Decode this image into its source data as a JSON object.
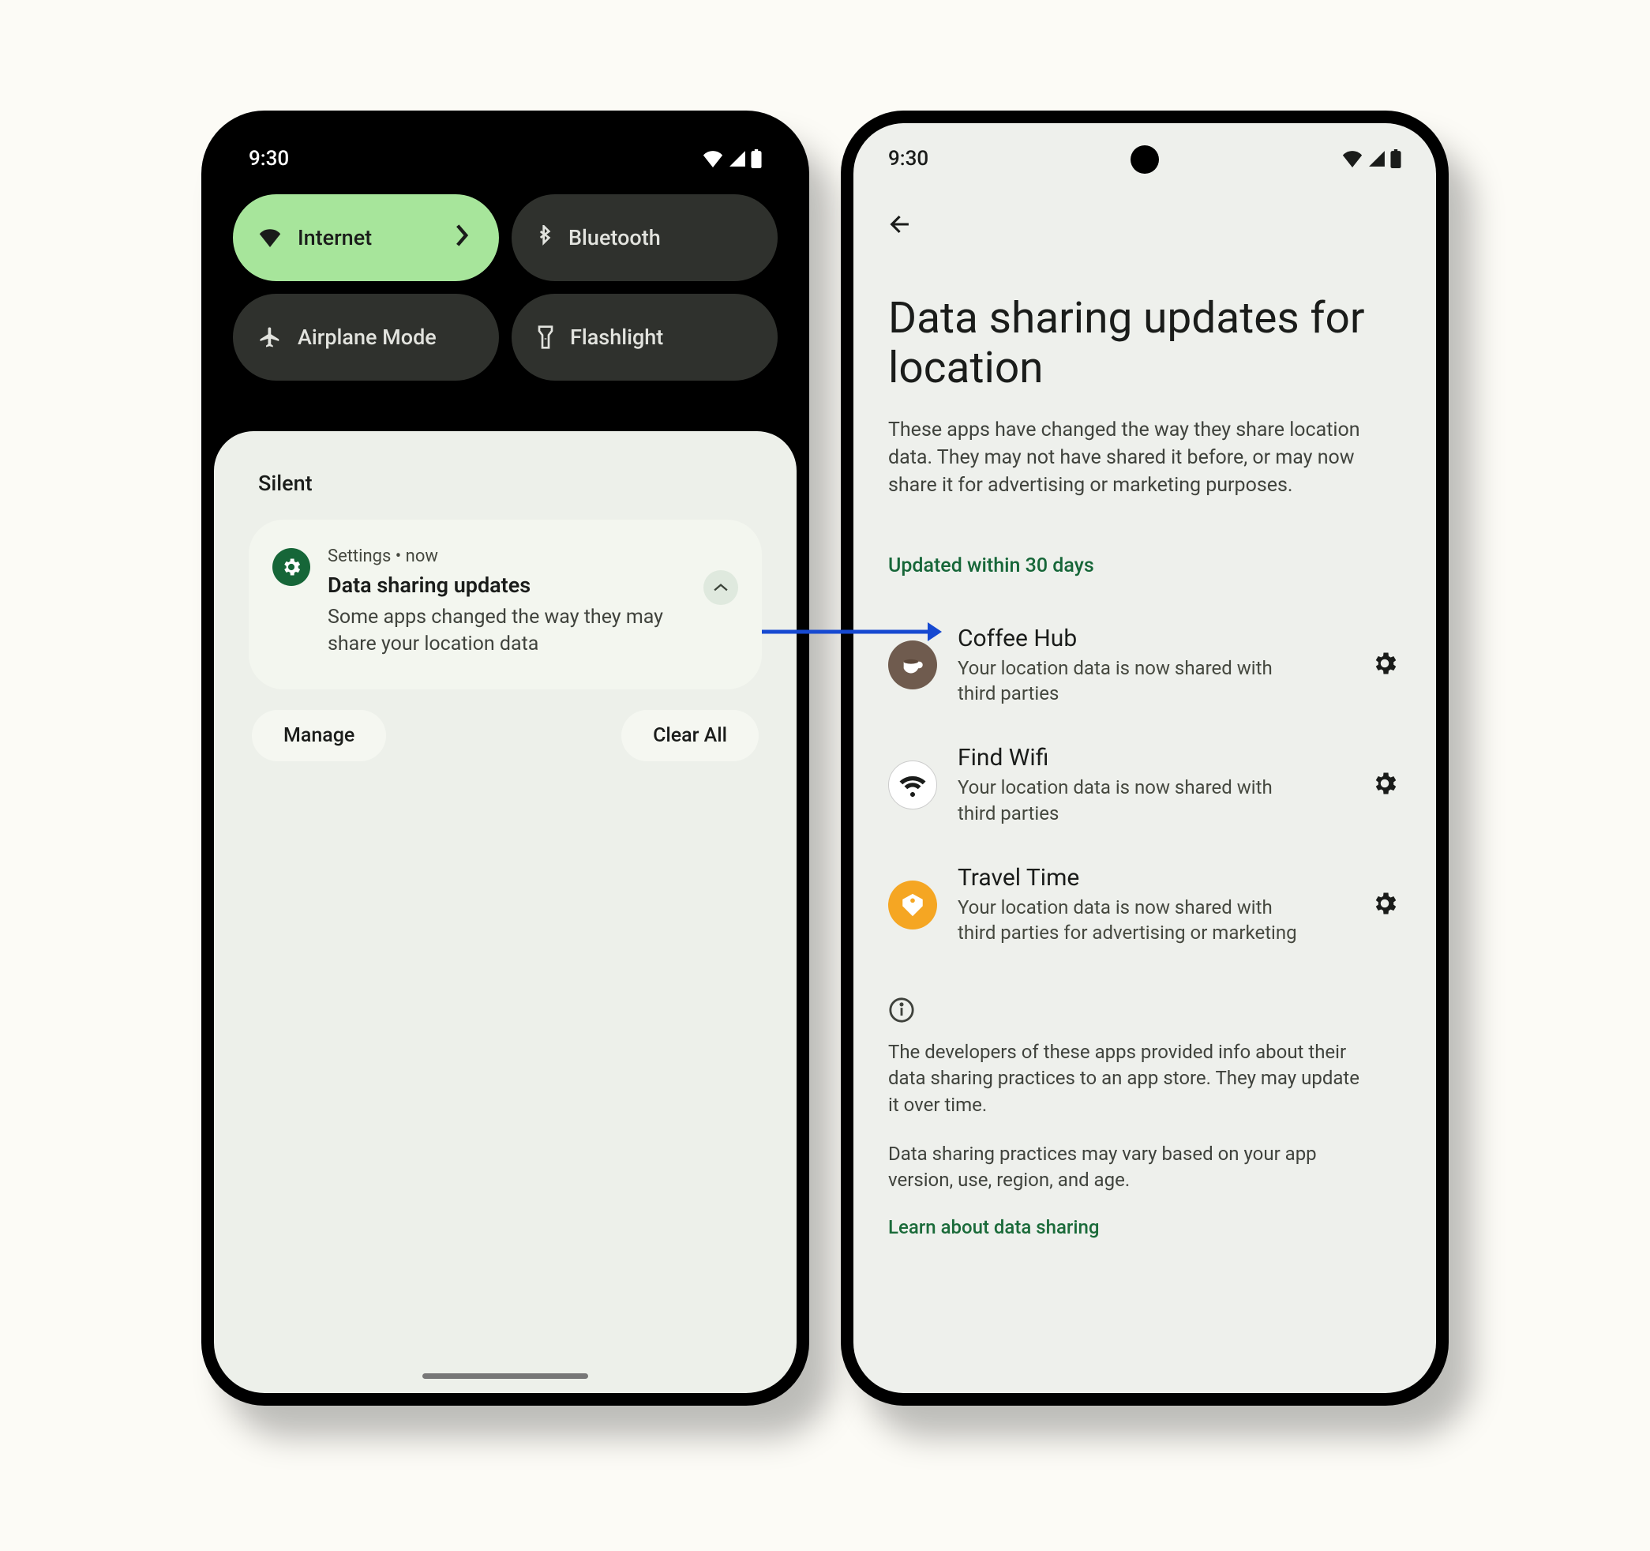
{
  "status": {
    "time": "9:30"
  },
  "qs": {
    "internet": "Internet",
    "bluetooth": "Bluetooth",
    "airplane": "Airplane Mode",
    "flashlight": "Flashlight"
  },
  "shade": {
    "silent_label": "Silent",
    "manage": "Manage",
    "clear_all": "Clear All"
  },
  "notif": {
    "meta": "Settings  •  now",
    "title": "Data sharing updates",
    "body": "Some apps changed the way they may share your location data"
  },
  "page": {
    "title": "Data sharing updates for location",
    "description": "These apps have changed the way they share location data. They may not have shared it before, or may now share it for advertising or marketing purposes.",
    "section_header": "Updated within 30 days",
    "info1": "The developers of these apps provided info about their data sharing practices to an app store. They may update it over time.",
    "info2": "Data sharing practices may vary based on your app version, use, region, and age.",
    "learn_more": "Learn about data sharing"
  },
  "apps": [
    {
      "name": "Coffee Hub",
      "sub": "Your location data is now shared with third parties",
      "icon": "coffee",
      "bg": "#6f5b4e"
    },
    {
      "name": "Find Wifi",
      "sub": "Your location data is now shared with third parties",
      "icon": "wifi",
      "bg": "#ffffff"
    },
    {
      "name": "Travel Time",
      "sub": "Your location data is now shared with third parties for advertising or marketing",
      "icon": "tag",
      "bg": "#f5a623"
    }
  ]
}
